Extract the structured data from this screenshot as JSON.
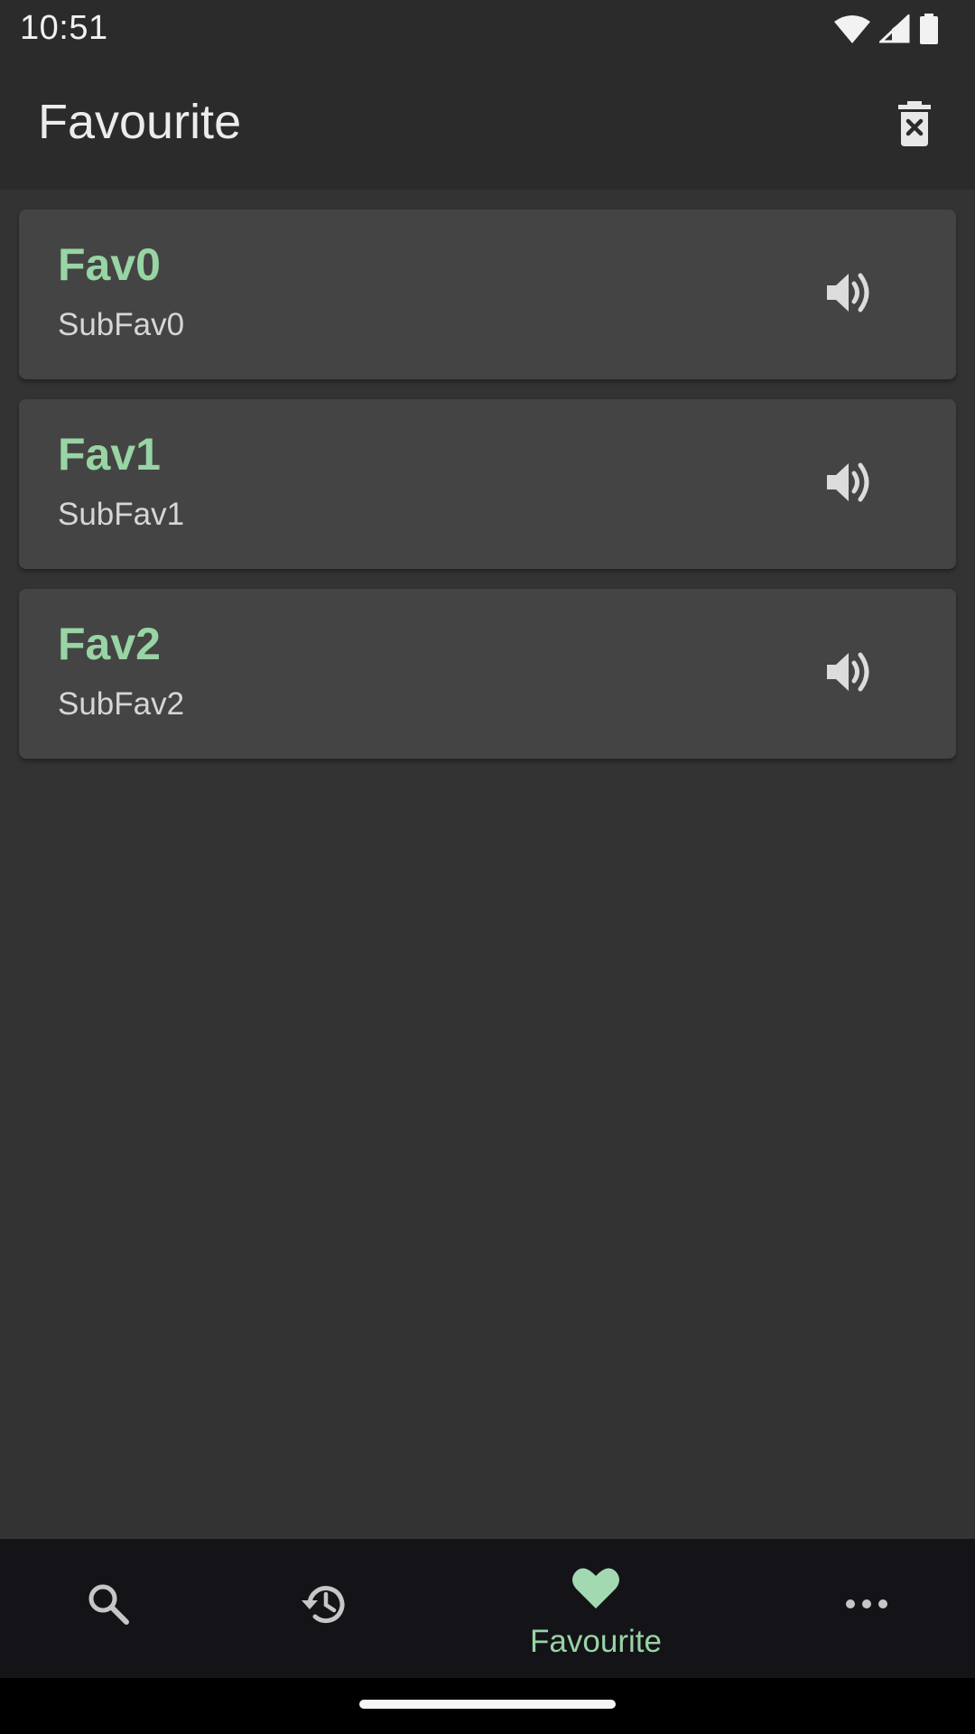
{
  "status_bar": {
    "time": "10:51",
    "icons": [
      "wifi-icon",
      "cell-signal-icon",
      "battery-icon"
    ]
  },
  "app_bar": {
    "title": "Favourite",
    "action_icon": "delete-sweep-icon"
  },
  "favourites": [
    {
      "title": "Fav0",
      "subtitle": "SubFav0",
      "action_icon": "speaker-icon"
    },
    {
      "title": "Fav1",
      "subtitle": "SubFav1",
      "action_icon": "speaker-icon"
    },
    {
      "title": "Fav2",
      "subtitle": "SubFav2",
      "action_icon": "speaker-icon"
    }
  ],
  "bottom_nav": {
    "items": [
      {
        "icon": "search-icon",
        "label": ""
      },
      {
        "icon": "history-icon",
        "label": ""
      },
      {
        "icon": "heart-icon",
        "label": "Favourite",
        "selected": true
      },
      {
        "icon": "more-icon",
        "label": ""
      }
    ]
  },
  "colors": {
    "background": "#333333",
    "bar": "#2b2b2b",
    "card": "#444444",
    "accent": "#98d4a4",
    "nav_background": "#141318"
  }
}
